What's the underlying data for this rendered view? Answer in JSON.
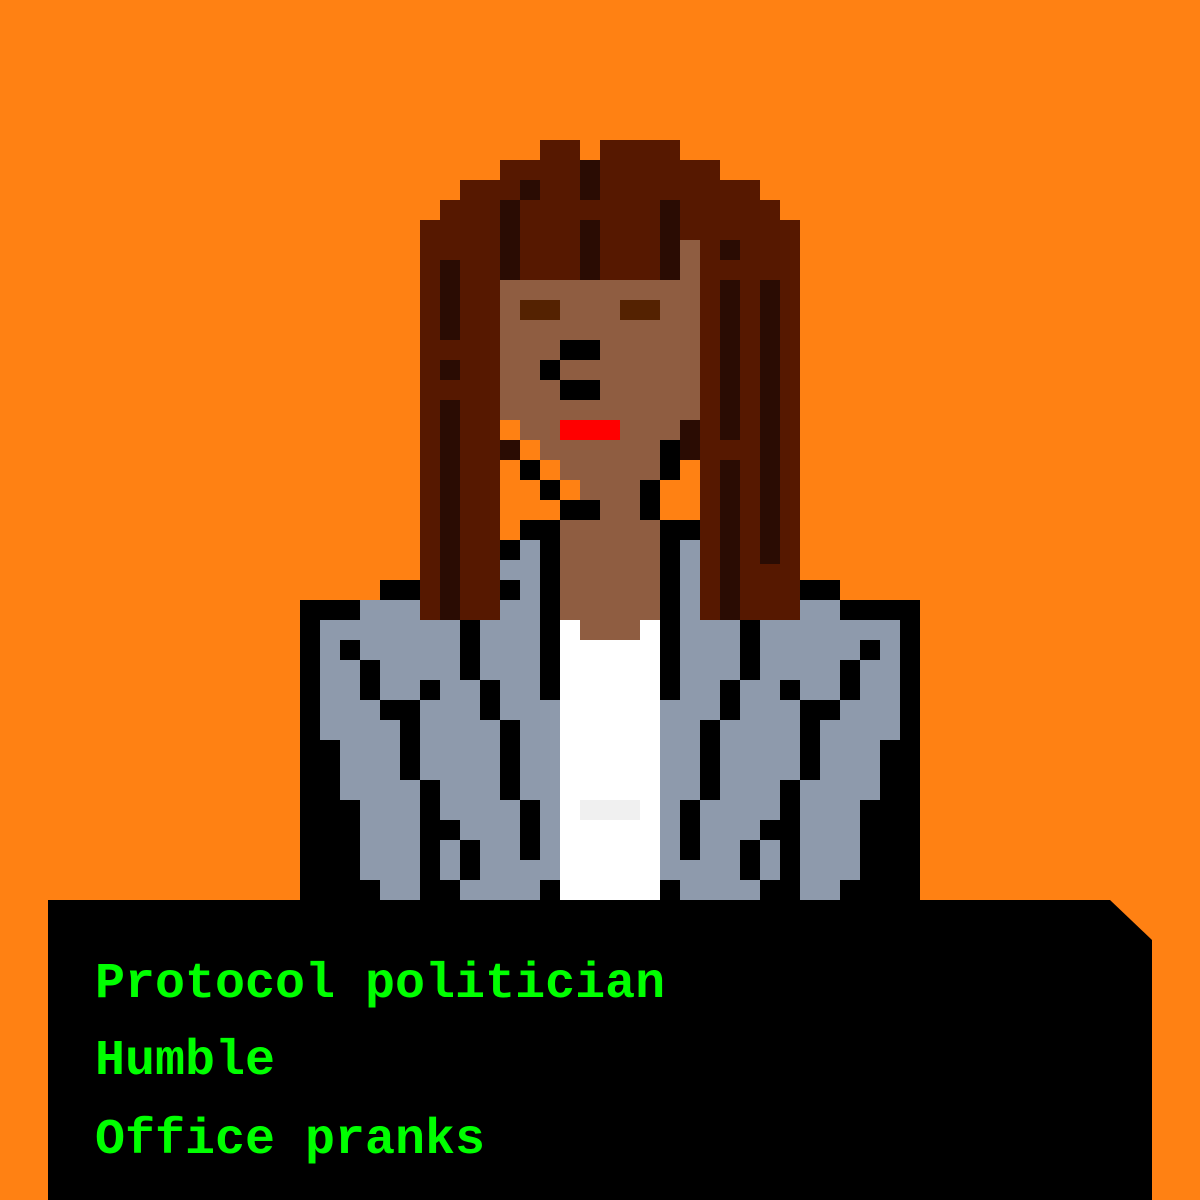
{
  "colors": {
    "background": "#FF8113",
    "hair": "#561800",
    "hair_shadow": "#2A0C03",
    "skin": "#8F5D41",
    "brows": "#542201",
    "lips": "#FF0000",
    "jacket": "#8E9AAC",
    "shirt": "#FFFFFF",
    "shirt_shade": "#F0F0F0",
    "outline": "#000000",
    "card": "#000000",
    "text": "#00FF00"
  },
  "portrait": {
    "subject": "pixel-art-avatar",
    "icons": [
      "hair",
      "face",
      "jacket",
      "shirt"
    ]
  },
  "traits": [
    "Protocol politician",
    "Humble",
    "Office pranks"
  ]
}
